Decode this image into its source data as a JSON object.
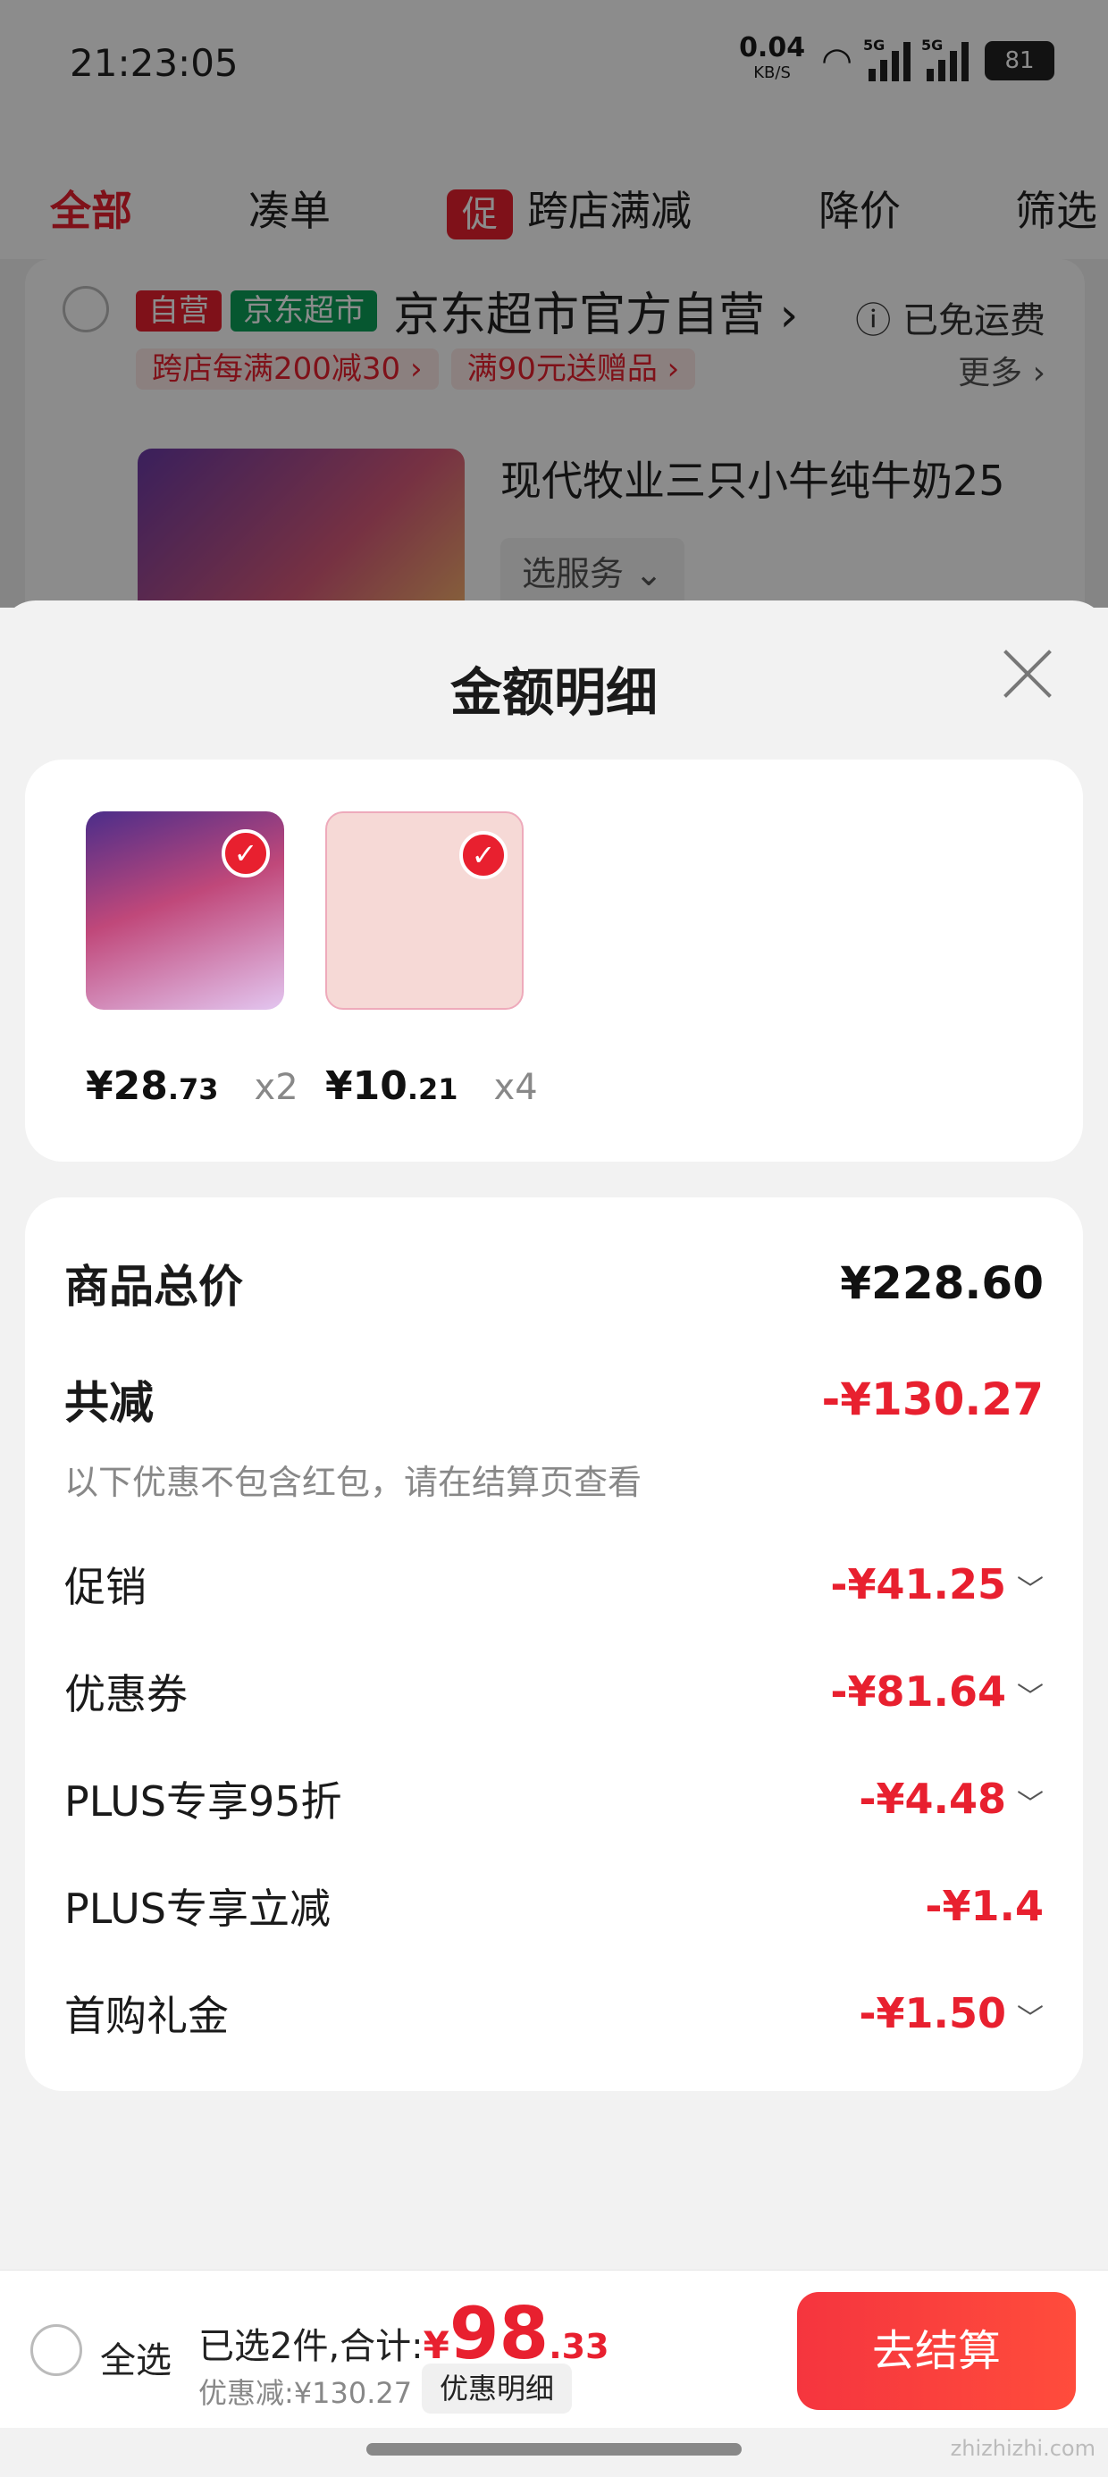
{
  "status_bar": {
    "time": "21:23:05",
    "net_speed": "0.04",
    "net_unit": "KB/S",
    "sig1": "5G",
    "sig2": "5G",
    "battery": "81"
  },
  "tabs": [
    {
      "label": "全部",
      "active": true
    },
    {
      "label": "凑单"
    },
    {
      "label": "跨店满减",
      "badge": "促"
    },
    {
      "label": "降价"
    },
    {
      "label": "筛选"
    }
  ],
  "store": {
    "tag_self": "自营",
    "tag_market": "京东超市",
    "name": "京东超市官方自营",
    "freight": "已免运费",
    "chips": [
      "跨店每满200减30",
      "满90元送赠品"
    ],
    "more": "更多",
    "product_name": "现代牧业三只小牛纯牛奶25",
    "service": "选服务"
  },
  "sheet": {
    "title": "金额明细",
    "items": [
      {
        "price_int": "¥28",
        "price_dec": ".73",
        "qty": "x2"
      },
      {
        "price_int": "¥10",
        "price_dec": ".21",
        "qty": "x4"
      }
    ],
    "total_label": "商品总价",
    "total_value": "¥228.60",
    "reduce_label": "共减",
    "reduce_value": "-¥130.27",
    "note": "以下优惠不包含红包，请在结算页查看",
    "discounts": [
      {
        "label": "促销",
        "value": "-¥41.25"
      },
      {
        "label": "优惠券",
        "value": "-¥81.64"
      },
      {
        "label": "PLUS专享95折",
        "value": "-¥4.48"
      },
      {
        "label": "PLUS专享立减",
        "value": "-¥1.4"
      },
      {
        "label": "首购礼金",
        "value": "-¥1.50"
      }
    ]
  },
  "bottom": {
    "select_all": "全选",
    "selected_text": "已选2件,合计:",
    "yen": "¥",
    "total_int": "98",
    "total_dec": ".33",
    "discount_text": "优惠减:¥130.27",
    "discount_detail": "优惠明细",
    "checkout": "去结算"
  },
  "watermark": "zhizhizhi.com",
  "colors": {
    "accent": "#e8202f",
    "market_green": "#0b9e58"
  }
}
